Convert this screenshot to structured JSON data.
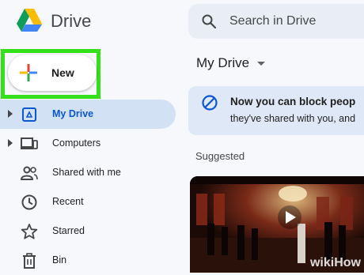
{
  "header": {
    "app_name": "Drive",
    "search_placeholder": "Search in Drive"
  },
  "new_button": {
    "label": "New"
  },
  "sidebar": {
    "items": [
      {
        "label": "My Drive",
        "icon": "my-drive-icon",
        "active": true,
        "expandable": true
      },
      {
        "label": "Computers",
        "icon": "computers-icon",
        "active": false,
        "expandable": true
      },
      {
        "label": "Shared with me",
        "icon": "shared-icon",
        "active": false,
        "expandable": false
      },
      {
        "label": "Recent",
        "icon": "clock-icon",
        "active": false,
        "expandable": false
      },
      {
        "label": "Starred",
        "icon": "star-icon",
        "active": false,
        "expandable": false
      },
      {
        "label": "Bin",
        "icon": "bin-icon",
        "active": false,
        "expandable": false
      }
    ]
  },
  "main": {
    "title": "My Drive",
    "banner": {
      "line1": "Now you can block peop",
      "line2": "they've shared with you, and"
    },
    "section_label": "Suggested"
  },
  "watermark": "wikiHow",
  "colors": {
    "highlight": "#33e01a",
    "accent": "#0b57d0",
    "active_nav_bg": "#d3e1f5",
    "banner_bg": "#dfe8f6"
  }
}
